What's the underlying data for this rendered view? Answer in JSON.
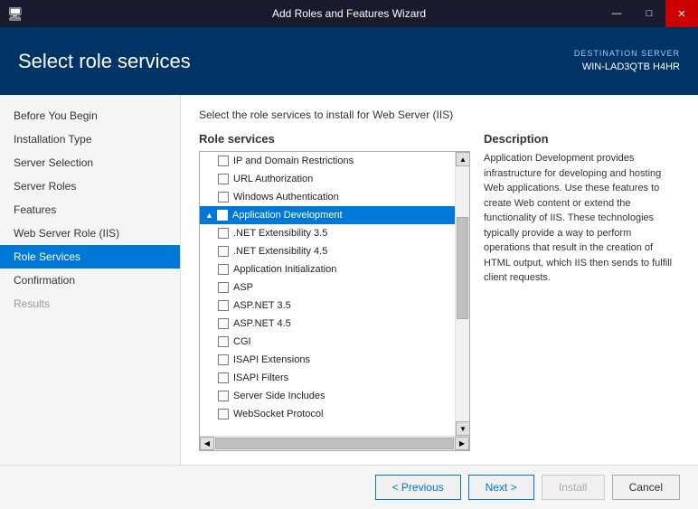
{
  "titleBar": {
    "title": "Add Roles and Features Wizard",
    "iconLabel": "wizard-icon",
    "minBtn": "—",
    "maxBtn": "□",
    "closeBtn": "✕"
  },
  "header": {
    "title": "Select role services",
    "destinationLabel": "DESTINATION SERVER",
    "serverName": "WIN-LAD3QTB H4HR"
  },
  "instruction": "Select the role services to install for Web Server (IIS)",
  "sidebar": {
    "items": [
      {
        "label": "Before You Begin",
        "state": "normal"
      },
      {
        "label": "Installation Type",
        "state": "normal"
      },
      {
        "label": "Server Selection",
        "state": "normal"
      },
      {
        "label": "Server Roles",
        "state": "normal"
      },
      {
        "label": "Features",
        "state": "normal"
      },
      {
        "label": "Web Server Role (IIS)",
        "state": "normal"
      },
      {
        "label": "Role Services",
        "state": "active"
      },
      {
        "label": "Confirmation",
        "state": "normal"
      },
      {
        "label": "Results",
        "state": "dimmed"
      }
    ]
  },
  "panels": {
    "roleServicesTitle": "Role services",
    "descriptionTitle": "Description",
    "descriptionText": "Application Development provides infrastructure for developing and hosting Web applications. Use these features to create Web content or extend the functionality of IIS. These technologies typically provide a way to perform operations that result in the creation of HTML output, which IIS then sends to fulfill client requests.",
    "listItems": [
      {
        "label": "IP and Domain Restrictions",
        "indent": 1,
        "checkbox": true,
        "checked": false,
        "selected": false
      },
      {
        "label": "URL Authorization",
        "indent": 1,
        "checkbox": true,
        "checked": false,
        "selected": false
      },
      {
        "label": "Windows Authentication",
        "indent": 1,
        "checkbox": true,
        "checked": false,
        "selected": false
      },
      {
        "label": "Application Development",
        "indent": 0,
        "checkbox": true,
        "checked": false,
        "selected": true,
        "arrow": "▲",
        "category": true
      },
      {
        "label": ".NET Extensibility 3.5",
        "indent": 1,
        "checkbox": true,
        "checked": false,
        "selected": false
      },
      {
        "label": ".NET Extensibility 4.5",
        "indent": 1,
        "checkbox": true,
        "checked": false,
        "selected": false
      },
      {
        "label": "Application Initialization",
        "indent": 1,
        "checkbox": true,
        "checked": false,
        "selected": false
      },
      {
        "label": "ASP",
        "indent": 1,
        "checkbox": true,
        "checked": false,
        "selected": false
      },
      {
        "label": "ASP.NET 3.5",
        "indent": 1,
        "checkbox": true,
        "checked": false,
        "selected": false
      },
      {
        "label": "ASP.NET 4.5",
        "indent": 1,
        "checkbox": true,
        "checked": false,
        "selected": false
      },
      {
        "label": "CGI",
        "indent": 1,
        "checkbox": true,
        "checked": false,
        "selected": false
      },
      {
        "label": "ISAPI Extensions",
        "indent": 1,
        "checkbox": true,
        "checked": false,
        "selected": false
      },
      {
        "label": "ISAPI Filters",
        "indent": 1,
        "checkbox": true,
        "checked": false,
        "selected": false
      },
      {
        "label": "Server Side Includes",
        "indent": 1,
        "checkbox": true,
        "checked": false,
        "selected": false
      },
      {
        "label": "WebSocket Protocol",
        "indent": 1,
        "checkbox": true,
        "checked": false,
        "selected": false
      }
    ]
  },
  "footer": {
    "previousLabel": "< Previous",
    "nextLabel": "Next >",
    "installLabel": "Install",
    "cancelLabel": "Cancel"
  }
}
